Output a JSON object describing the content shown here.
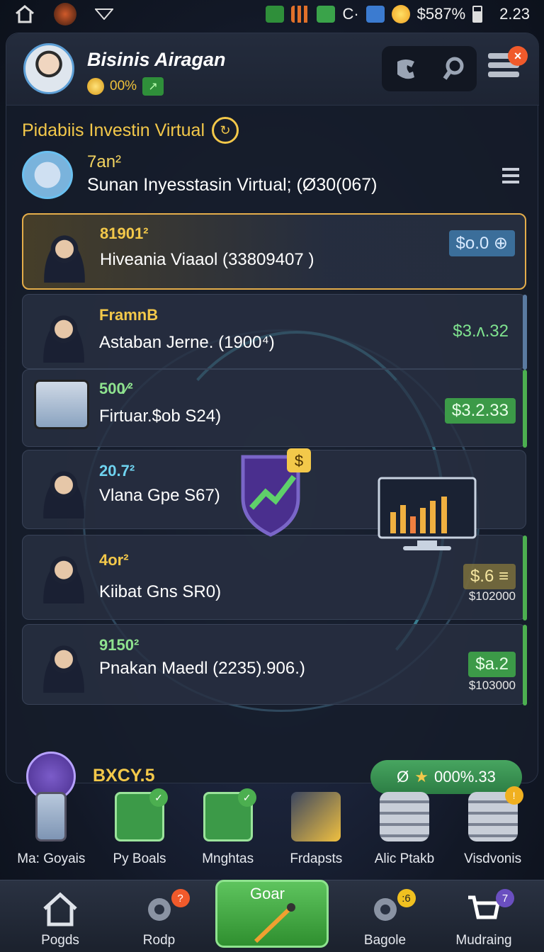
{
  "status_bar": {
    "battery_text": "$587%",
    "time": "2.23",
    "misc_text": "C·"
  },
  "header": {
    "name": "Bisinis Airagan",
    "coin_value": "00%"
  },
  "section": {
    "title": "Pidabiis Investin Virtual"
  },
  "summary": {
    "top": "7an²",
    "label": "Sunan Inyesstasin Virtual; (Ø30(067)"
  },
  "rows": [
    {
      "num": "81901²",
      "name": "Hiveania Viaaol (33809407 )",
      "value": "$o.0",
      "num_color": "#f3c84a"
    },
    {
      "num": "FramnB",
      "name": "Astaban Jerne. (1900⁴)",
      "value": "$3.ʌ.32",
      "num_color": "#f3c84a"
    },
    {
      "num": "500⁄²",
      "name": "Firtuar.$ob S24)",
      "value": "$3.2.33",
      "num_color": "#8fe38f"
    },
    {
      "num": "20.7²",
      "name": "Vlana  Gpe S67)",
      "num_color": "#6fd3f0"
    },
    {
      "num": "4or²",
      "name": "Kiibat Gns SR0)",
      "value": "$.6",
      "sub": "$102000",
      "num_color": "#f3c84a"
    },
    {
      "num": "9150²",
      "name": "Pnakan Maedl (2235).906.)",
      "value": "$a.2",
      "sub": "$103000",
      "num_color": "#8fe38f"
    }
  ],
  "footer": {
    "label": "BXCY.5",
    "pill": "000%.33"
  },
  "tools": [
    {
      "label": "Ma: Goyais"
    },
    {
      "label": "Py Boals"
    },
    {
      "label": "Mnghtas"
    },
    {
      "label": "Frdapsts"
    },
    {
      "label": "Alic Ptakb"
    },
    {
      "label": "Visdvonis"
    }
  ],
  "nav": {
    "items": [
      {
        "label": "Pogds"
      },
      {
        "label": "Rodp",
        "badge": "?"
      },
      {
        "label": "Bagole",
        "badge": ":6"
      },
      {
        "label": "Mudraing",
        "badge": "7"
      }
    ],
    "center_label": "Goar"
  },
  "colors": {
    "accent": "#f3c84a",
    "green": "#4caf50",
    "purple": "#6a4fc0"
  }
}
